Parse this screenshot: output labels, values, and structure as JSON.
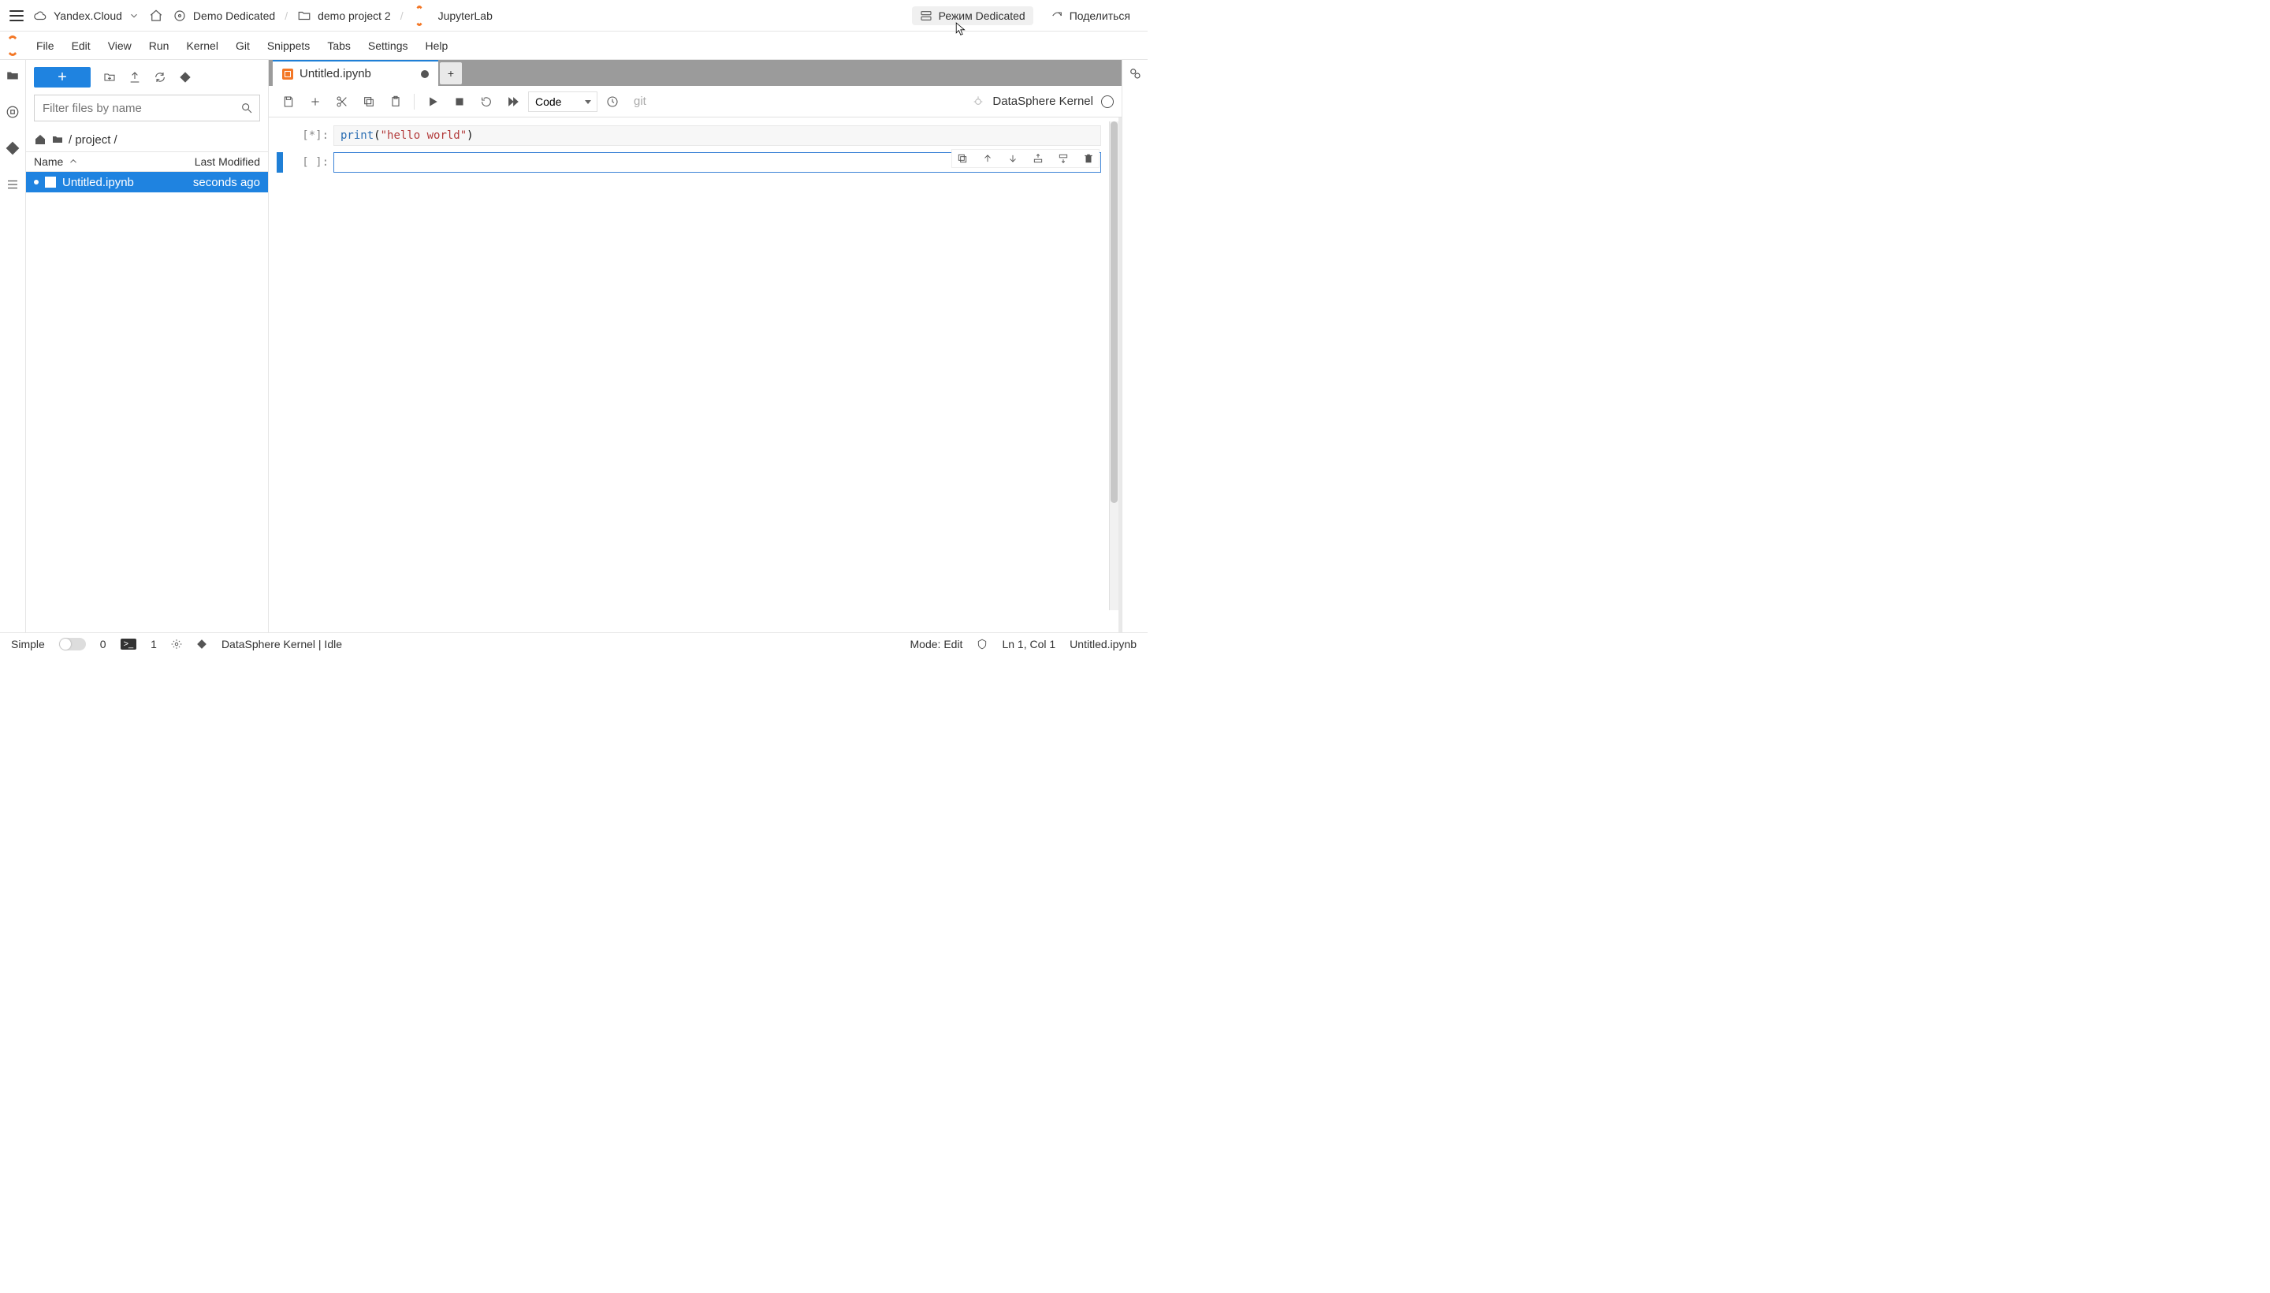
{
  "topbar": {
    "cloud": "Yandex.Cloud",
    "crumbs": [
      "Demo Dedicated",
      "demo project 2",
      "JupyterLab"
    ],
    "mode_btn": "Режим Dedicated",
    "share_btn": "Поделиться"
  },
  "menu": [
    "File",
    "Edit",
    "View",
    "Run",
    "Kernel",
    "Git",
    "Snippets",
    "Tabs",
    "Settings",
    "Help"
  ],
  "filebrowser": {
    "filter_placeholder": "Filter files by name",
    "path": "/ project /",
    "col_name": "Name",
    "col_mod": "Last Modified",
    "rows": [
      {
        "name": "Untitled.ipynb",
        "mod": "seconds ago"
      }
    ]
  },
  "tab_title": "Untitled.ipynb",
  "nb_toolbar": {
    "celltype": "Code",
    "git_label": "git",
    "kernel_name": "DataSphere Kernel"
  },
  "cells": {
    "c0_prompt": "[*]:",
    "c0_code_fn": "print",
    "c0_code_lp": "(",
    "c0_code_str": "\"hello world\"",
    "c0_code_rp": ")",
    "c1_prompt": "[ ]:"
  },
  "cell_tool_names": [
    "duplicate",
    "move-up",
    "move-down",
    "insert-above",
    "insert-below",
    "delete"
  ],
  "status": {
    "simple": "Simple",
    "zero": "0",
    "one": "1",
    "kernel": "DataSphere Kernel | Idle",
    "mode": "Mode: Edit",
    "pos": "Ln 1, Col 1",
    "file": "Untitled.ipynb"
  }
}
